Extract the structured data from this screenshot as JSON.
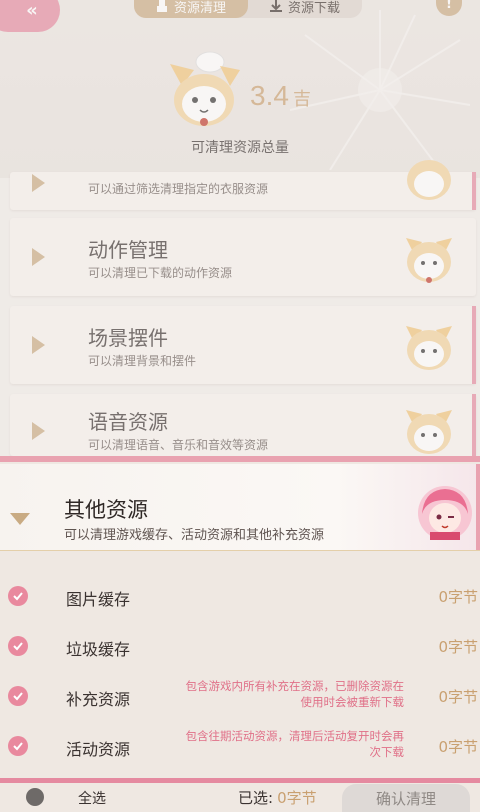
{
  "header": {
    "back_icon": "double-chevron-left-icon",
    "tabs": [
      {
        "label": "资源清理",
        "icon": "broom-icon",
        "active": true
      },
      {
        "label": "资源下载",
        "icon": "download-icon",
        "active": false
      }
    ],
    "help_label": "!",
    "total_value": "3.4",
    "total_unit": "吉",
    "total_label": "可清理资源总量"
  },
  "categories": [
    {
      "title": "",
      "desc": "可以通过筛选清理指定的衣服资源",
      "icon": "cat-mascot-icon"
    },
    {
      "title": "动作管理",
      "desc": "可以清理已下载的动作资源",
      "icon": "cat-mascot-icon"
    },
    {
      "title": "场景摆件",
      "desc": "可以清理背景和摆件",
      "icon": "cat-mascot-icon"
    },
    {
      "title": "语音资源",
      "desc": "可以清理语音、音乐和音效等资源",
      "icon": "cat-mascot-icon"
    }
  ],
  "panel": {
    "title": "其他资源",
    "desc": "可以清理游戏缓存、活动资源和其他补充资源",
    "avatar_icon": "pink-hair-girl-avatar-icon",
    "items": [
      {
        "name": "图片缓存",
        "note": "",
        "size": "0字节",
        "checked": true
      },
      {
        "name": "垃圾缓存",
        "note": "",
        "size": "0字节",
        "checked": true
      },
      {
        "name": "补充资源",
        "note": "包含游戏内所有补充在资源，已删除资源在使用时会被重新下载",
        "size": "0字节",
        "checked": true
      },
      {
        "name": "活动资源",
        "note": "包含往期活动资源，清理后活动复开时会再次下载",
        "size": "0字节",
        "checked": true
      }
    ]
  },
  "footer": {
    "select_all_label": "全选",
    "selected_label": "已选:",
    "selected_value": "0字节",
    "confirm_label": "确认清理"
  },
  "colors": {
    "accent_pink": "#e58aa0",
    "gold": "#c9a070",
    "note_pink": "#e07088"
  }
}
